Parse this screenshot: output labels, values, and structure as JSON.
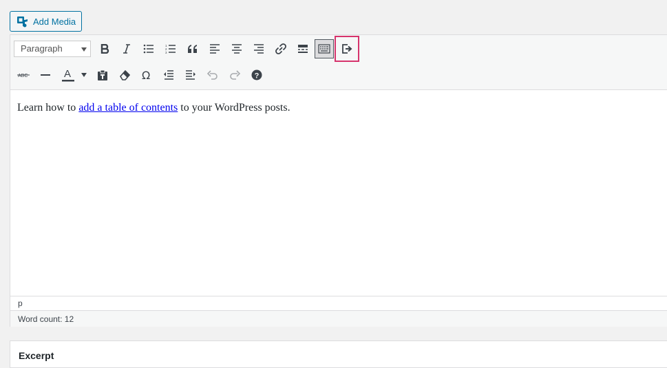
{
  "add_media": {
    "label": "Add Media"
  },
  "toolbar": {
    "format_select": "Paragraph",
    "row1": [
      "bold",
      "italic",
      "bulleted-list",
      "numbered-list",
      "blockquote",
      "align-left",
      "align-center",
      "align-right",
      "insert-link",
      "read-more",
      "toolbar-toggle",
      "exit-distraction-free"
    ],
    "row2": [
      "strikethrough",
      "horizontal-line",
      "text-color",
      "text-color-dropdown",
      "paste-as-text",
      "clear-formatting",
      "special-character",
      "decrease-indent",
      "increase-indent",
      "undo",
      "redo",
      "keyboard-shortcuts"
    ]
  },
  "content": {
    "before": "Learn how to ",
    "link_text": "add a table of contents",
    "after": " to your WordPress posts."
  },
  "path_bar": {
    "element": "p"
  },
  "status": {
    "word_count": "Word count: 12"
  },
  "excerpt": {
    "title": "Excerpt"
  },
  "colors": {
    "accent": "#0071a1",
    "highlight_border": "#d6336c",
    "link": "#0000ee"
  }
}
